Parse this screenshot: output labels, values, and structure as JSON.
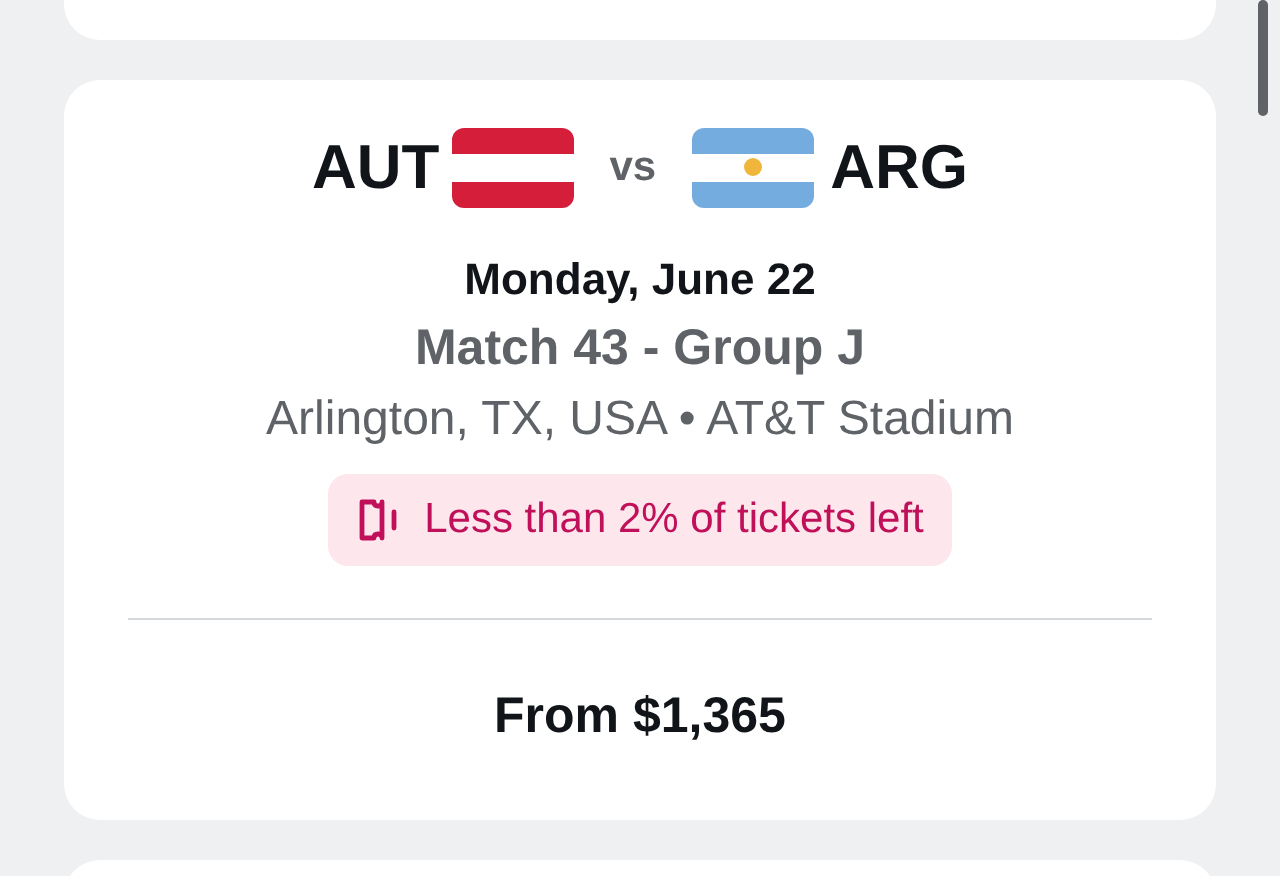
{
  "match": {
    "home_team": "AUT",
    "away_team": "ARG",
    "separator": "vs",
    "date": "Monday, June 22",
    "title": "Match 43 - Group J",
    "location": "Arlington, TX, USA • AT&T Stadium",
    "availability": "Less than 2% of tickets left",
    "price": "From $1,365"
  }
}
